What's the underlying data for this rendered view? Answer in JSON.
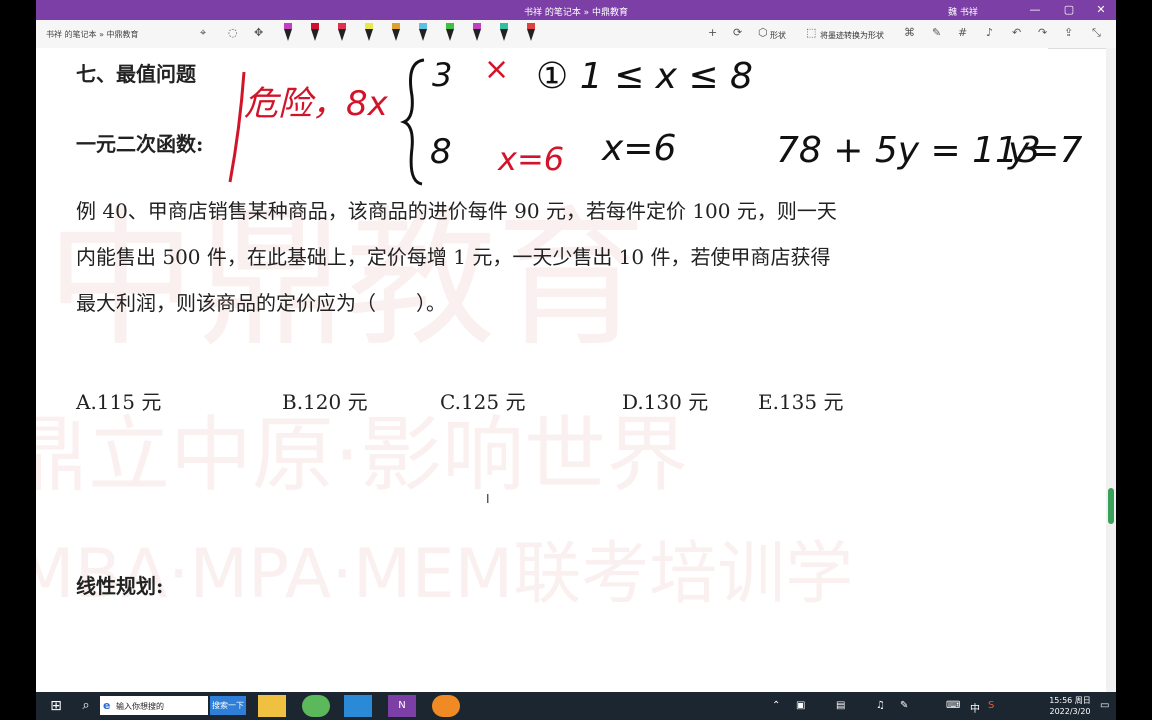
{
  "window": {
    "title": "书祥 的笔记本 » 中鼎教育",
    "user": "魏 书祥",
    "controls": [
      "—",
      "▢",
      "✕"
    ]
  },
  "toolbar": {
    "breadcrumb": "书祥 的笔记本 » 中鼎教育",
    "shape_label": "形状",
    "convert_label": "将墨迹转换为形状",
    "pen_colors": [
      "#c040c0",
      "#d01030",
      "#e03050",
      "#e8e84c",
      "#e0a030",
      "#60c0e0",
      "#40c040",
      "#c040c0",
      "#30c0a0",
      "#e04040"
    ]
  },
  "document": {
    "section_title": "七、最值问题",
    "subsection_quadratic": "一元二次函数:",
    "problem_lines": [
      "例 40、甲商店销售某种商品，该商品的进价每件 90 元，若每件定价 100 元，则一天",
      "内能售出 500 件，在此基础上，定价每增 1 元，一天少售出 10 件，若使甲商店获得",
      "最大利润，则该商品的定价应为（　　）。"
    ],
    "options": [
      "A.115 元",
      "B.120 元",
      "C.125 元",
      "D.130 元",
      "E.135 元"
    ],
    "subsection_linear": "线性规划:"
  },
  "watermark": {
    "big": "中鼎教育",
    "line1": "鼎立中原·影响世界",
    "line2": "MBA·MPA·MEM联考培训学"
  },
  "ink": {
    "red_note": "危险，8x",
    "brace_top": "3",
    "brace_bottom": "8",
    "cross": "×",
    "x_eq6_a": "x=6",
    "range": "① 1 ≤ x ≤ 8",
    "x_eq6_b": "x=6",
    "equation": "78 + 5y = 113",
    "y_eq7": "y=7"
  },
  "taskbar": {
    "search_placeholder": "输入你想搜的",
    "search_button": "搜索一下",
    "ime": "中",
    "time": "15:56 周日",
    "date": "2022/3/20"
  }
}
